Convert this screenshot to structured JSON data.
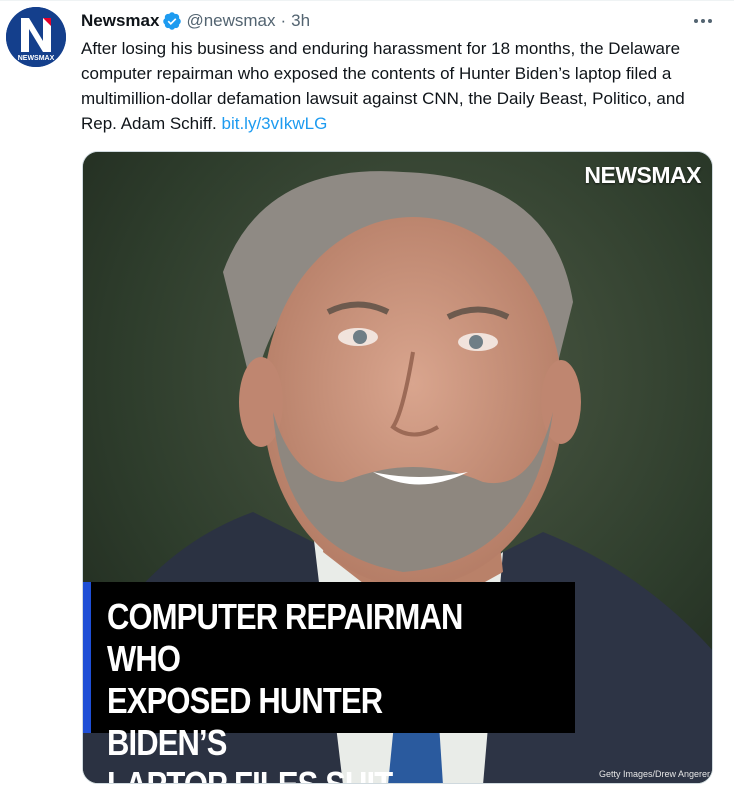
{
  "tweet": {
    "display_name": "Newsmax",
    "handle": "@newsmax",
    "separator": "·",
    "time": "3h",
    "text": "After losing his business and enduring harassment for 18 months, the Delaware computer repairman who exposed the contents of Hunter Biden’s laptop filed a multimillion-dollar defamation lawsuit against CNN, the Daily Beast, Politico, and Rep. Adam Schiff.",
    "link": "bit.ly/3vIkwLG",
    "avatar_label": "NEWSMAX"
  },
  "media": {
    "brand": "NEWSMAX",
    "headline": "COMPUTER REPAIRMAN WHO\nEXPOSED HUNTER BIDEN’S\nLAPTOP FILES SUIT",
    "credit": "Getty Images/Drew Angerer"
  },
  "colors": {
    "link": "#1d9bf0",
    "verified": "#1d9bf0",
    "avatar_bg": "#143f8c",
    "headline_bar": "#1f4fd6",
    "muted": "#536471"
  },
  "icons": {
    "verified": "verified-badge-icon",
    "more": "more-options-icon"
  }
}
